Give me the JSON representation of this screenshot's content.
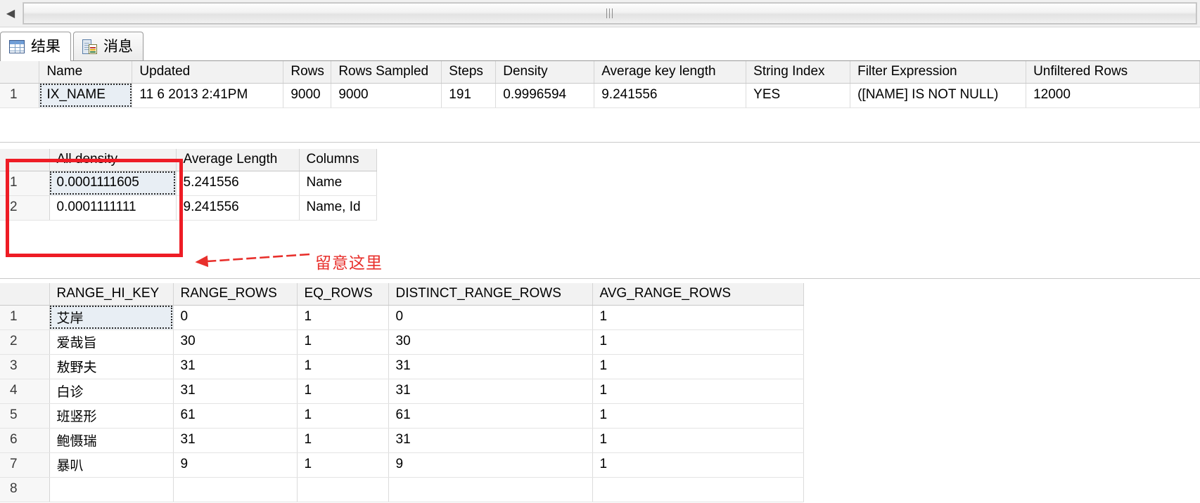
{
  "window": {
    "scrollbar": {
      "left_arrow_glyph": "◀",
      "name": "horizontal-scrollbar"
    }
  },
  "tabs": [
    {
      "label": "结果",
      "icon": "results-grid-icon",
      "active": true
    },
    {
      "label": "消息",
      "icon": "messages-icon",
      "active": false
    }
  ],
  "grid_stats": {
    "headers": [
      "Name",
      "Updated",
      "Rows",
      "Rows Sampled",
      "Steps",
      "Density",
      "Average key length",
      "String Index",
      "Filter Expression",
      "Unfiltered Rows"
    ],
    "rows": [
      {
        "num": "1",
        "cells": [
          "IX_NAME",
          "11  6 2013  2:41PM",
          "9000",
          "9000",
          "191",
          "0.9996594",
          "9.241556",
          "YES",
          "([NAME] IS NOT NULL)",
          "12000"
        ]
      }
    ]
  },
  "grid_density": {
    "headers": [
      "All density",
      "Average Length",
      "Columns"
    ],
    "rows": [
      {
        "num": "1",
        "cells": [
          "0.0001111605",
          "5.241556",
          "Name"
        ]
      },
      {
        "num": "2",
        "cells": [
          "0.0001111111",
          "9.241556",
          "Name, Id"
        ]
      }
    ]
  },
  "grid_histogram": {
    "headers": [
      "RANGE_HI_KEY",
      "RANGE_ROWS",
      "EQ_ROWS",
      "DISTINCT_RANGE_ROWS",
      "AVG_RANGE_ROWS"
    ],
    "rows": [
      {
        "num": "1",
        "cells": [
          "艾岸",
          "0",
          "1",
          "0",
          "1"
        ]
      },
      {
        "num": "2",
        "cells": [
          "爱哉旨",
          "30",
          "1",
          "30",
          "1"
        ]
      },
      {
        "num": "3",
        "cells": [
          "敖野夫",
          "31",
          "1",
          "31",
          "1"
        ]
      },
      {
        "num": "4",
        "cells": [
          "白诊",
          "31",
          "1",
          "31",
          "1"
        ]
      },
      {
        "num": "5",
        "cells": [
          "班竖形",
          "61",
          "1",
          "61",
          "1"
        ]
      },
      {
        "num": "6",
        "cells": [
          "鲍慑瑞",
          "31",
          "1",
          "31",
          "1"
        ]
      },
      {
        "num": "7",
        "cells": [
          "暴叭",
          "9",
          "1",
          "9",
          "1"
        ]
      },
      {
        "num": "8",
        "cells": [
          "",
          "",
          "",
          "",
          ""
        ]
      }
    ]
  },
  "annotation": {
    "text": "留意这里",
    "color": "#e8302c",
    "box_color": "#ee1c25"
  }
}
